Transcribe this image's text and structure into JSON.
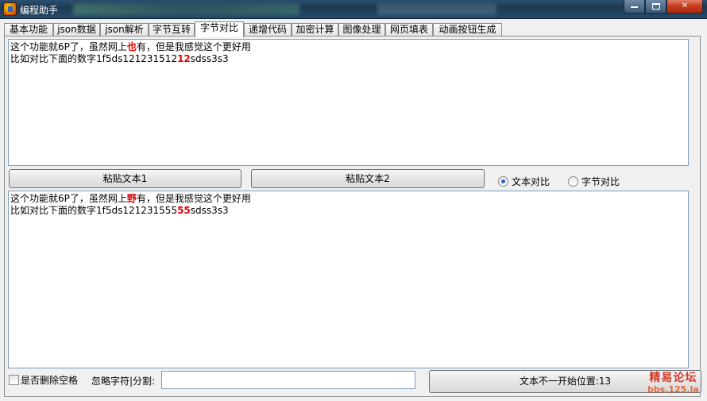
{
  "window": {
    "title": "编程助手",
    "buttons": {
      "minimize": "",
      "maximize": "",
      "close": "✕"
    }
  },
  "tabs": [
    {
      "label": "基本功能"
    },
    {
      "label": "json数据"
    },
    {
      "label": "json解析"
    },
    {
      "label": "字节互转"
    },
    {
      "label": "字节对比",
      "active": true
    },
    {
      "label": "递增代码"
    },
    {
      "label": "加密计算"
    },
    {
      "label": "图像处理"
    },
    {
      "label": "网页填表"
    },
    {
      "label": "动画按钮生成"
    }
  ],
  "text1": {
    "line1": {
      "before": "这个功能就6P了，虽然网上",
      "diff": "也",
      "after": "有，但是我感觉这个更好用"
    },
    "line2": {
      "before": "比如对比下面的数字1f5ds121231512",
      "diff": "12",
      "after": "sdss3s3"
    }
  },
  "text2": {
    "line1": {
      "before": "这个功能就6P了，虽然网上",
      "diff": "野",
      "after": "有，但是我感觉这个更好用"
    },
    "line2": {
      "before": "比如对比下面的数字1f5ds121231555",
      "diff": "55",
      "after": "sdss3s3"
    }
  },
  "buttons": {
    "paste1": "粘贴文本1",
    "paste2": "粘贴文本2",
    "result": "文本不一开始位置:13"
  },
  "compare_mode": {
    "options": [
      {
        "label": "文本对比",
        "selected": true
      },
      {
        "label": "字节对比",
        "selected": false
      }
    ]
  },
  "options": {
    "remove_spaces_label": "是否删除空格",
    "remove_spaces_checked": false,
    "ignore_chars_label": "忽略字符|分割:",
    "ignore_chars_value": ""
  },
  "watermark": {
    "line1": "精易论坛",
    "line2": "bbs.125.la"
  },
  "colors": {
    "diff_highlight": "#e00000",
    "titlebar": "#244a6a",
    "radio_selected": "#2a62b8"
  }
}
